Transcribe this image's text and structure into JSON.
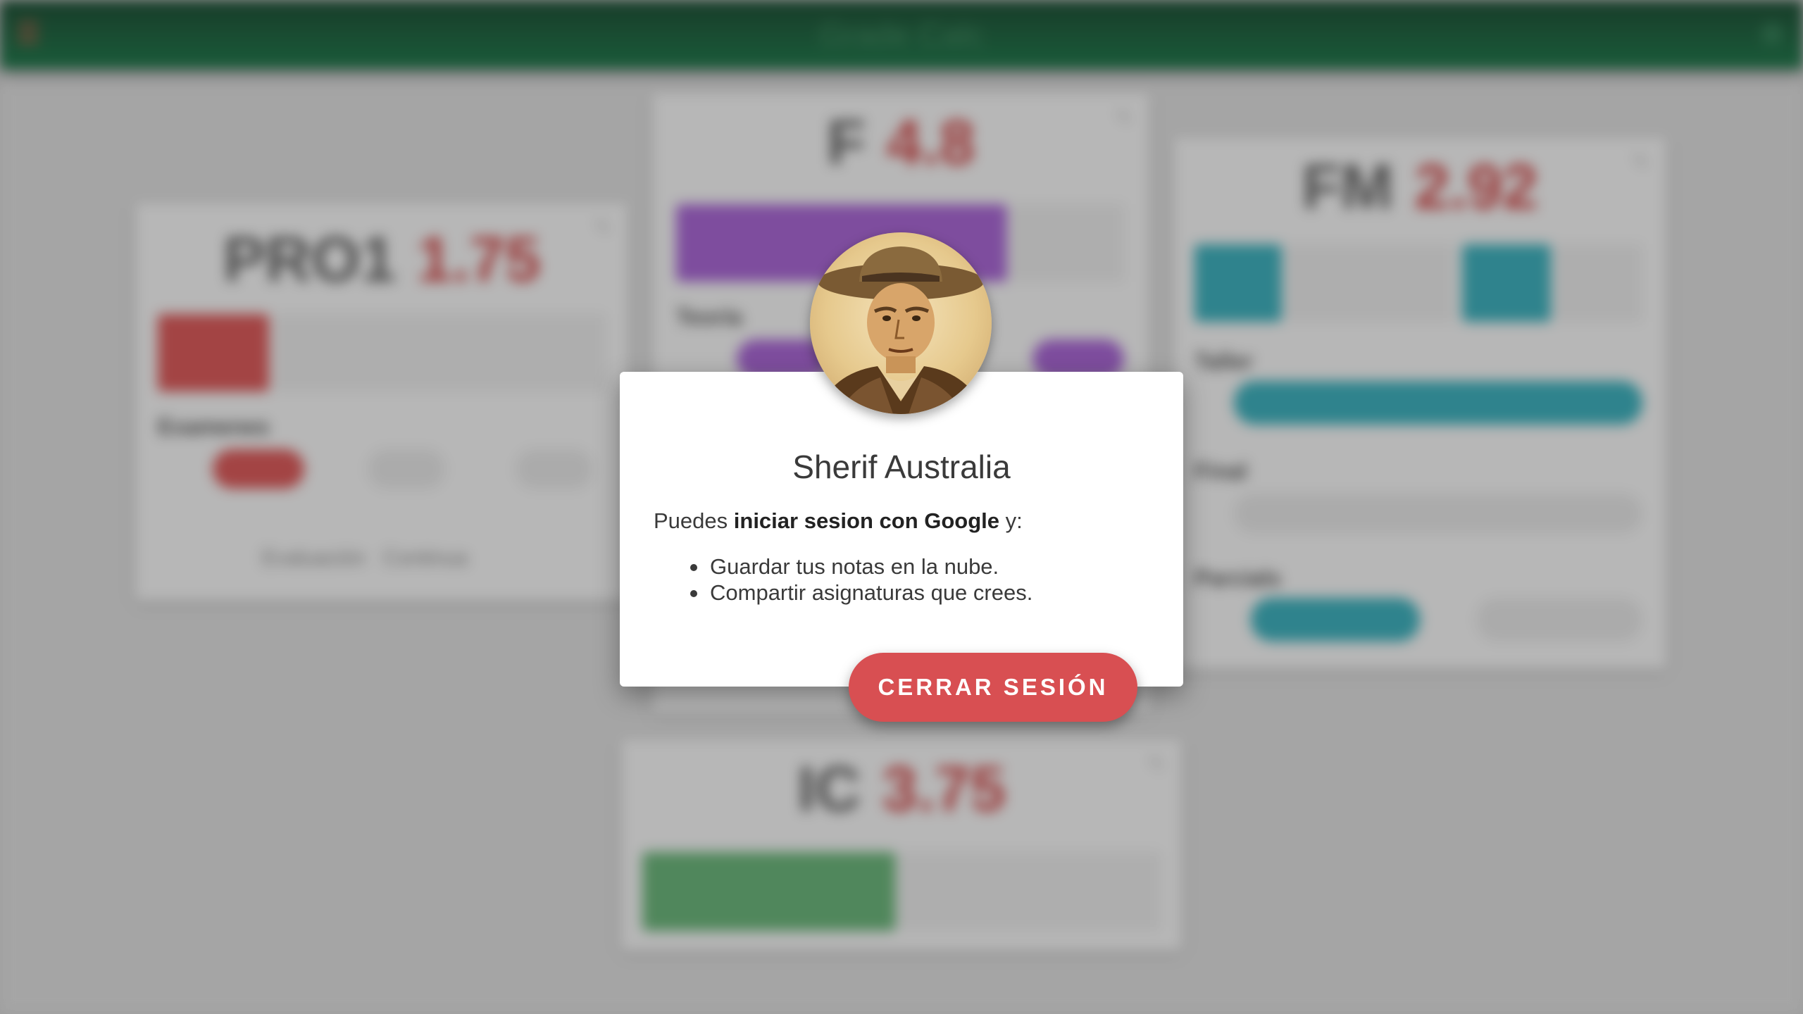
{
  "topbar": {
    "title": "Grade Calc"
  },
  "cards": {
    "pro1": {
      "code": "PRO1",
      "value": "1.75",
      "section": "Examenes",
      "footer": "Evaluación",
      "footer_select": "Continua"
    },
    "f": {
      "code": "F",
      "value": "4.8",
      "section": "Teoría"
    },
    "fm": {
      "code": "FM",
      "value": "2.92",
      "section_1": "Taller",
      "section_2": "Final",
      "section_3": "Parcials"
    },
    "ic": {
      "code": "IC",
      "value": "3.75"
    }
  },
  "dialog": {
    "title": "Sherif Australia",
    "intro_prefix": "Puedes ",
    "intro_bold": "iniciar sesion con Google",
    "intro_suffix": " y:",
    "items": [
      "Guardar tus notas en la nube.",
      "Compartir asignaturas que crees."
    ],
    "logout_label": "CERRAR SESIÓN"
  },
  "colors": {
    "topbar": "#0c6a3a",
    "accent_red": "#d84f52",
    "purple": "#9b55c9",
    "teal": "#2aa3b0",
    "green": "#5aa86a"
  },
  "icons": {
    "menu": "hamburger-icon",
    "settings": "gear-icon",
    "edit": "pencil-icon"
  }
}
